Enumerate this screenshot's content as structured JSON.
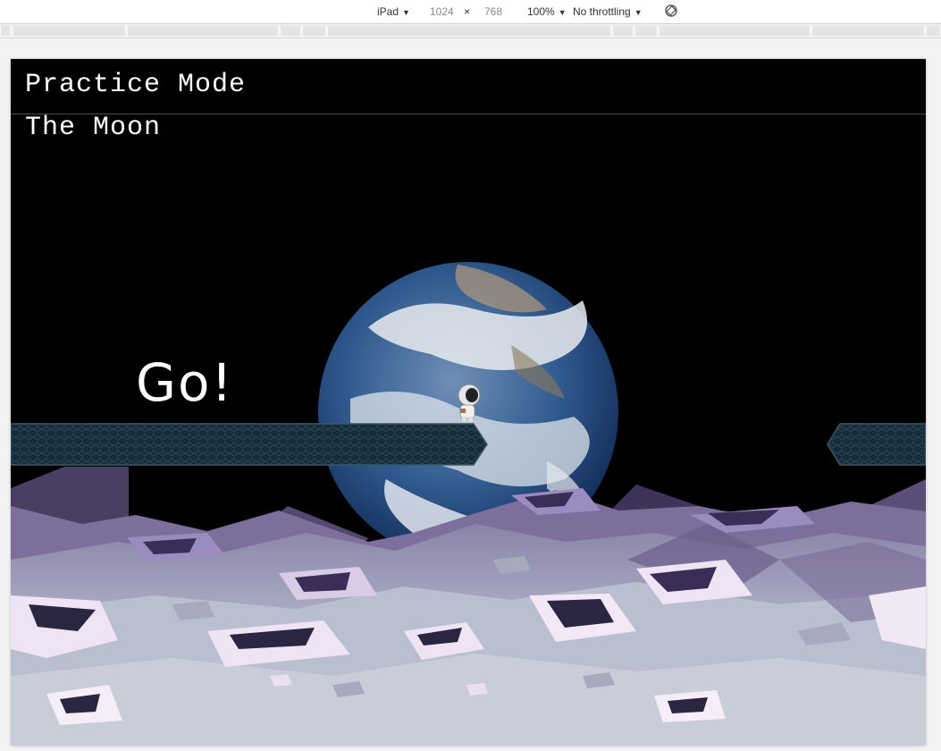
{
  "devtools": {
    "device": "iPad",
    "width": "1024",
    "times": "×",
    "height": "768",
    "zoom": "100%",
    "throttling": "No throttling"
  },
  "game": {
    "mode_title": "Practice Mode",
    "level_name": "The Moon",
    "start_prompt": "Go!"
  }
}
